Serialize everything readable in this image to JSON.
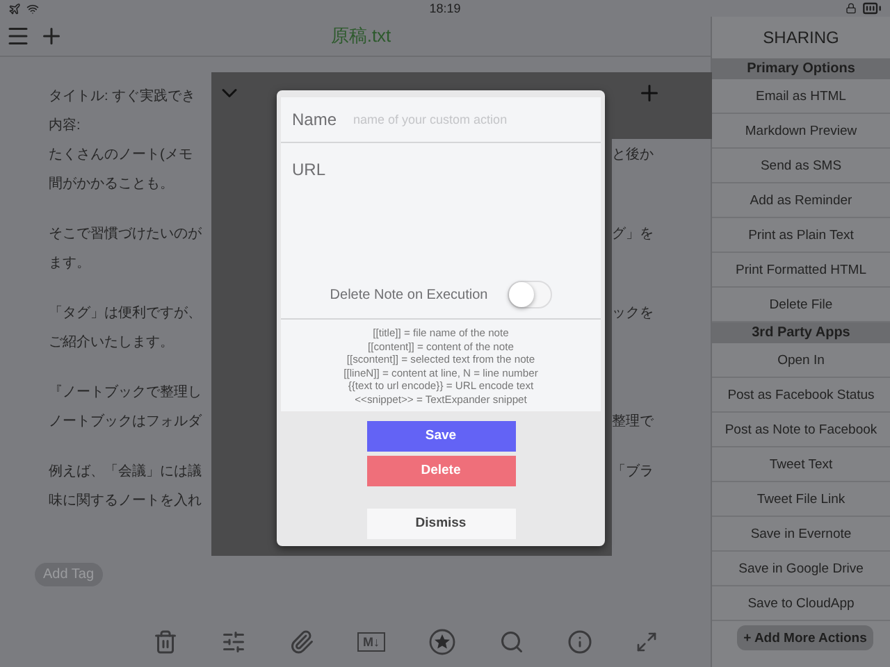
{
  "status_bar": {
    "time": "18:19"
  },
  "nav": {
    "title": "原稿.txt"
  },
  "note": {
    "paragraphs": [
      {
        "lines": [
          {
            "left": "タイトル: すぐ実践でき"
          },
          {
            "left": "内容:"
          },
          {
            "left": "たくさんのノート(メモ",
            "right": "と後か"
          },
          {
            "left": "間がかかることも。"
          }
        ]
      },
      {
        "lines": [
          {
            "left": "そこで習慣づけたいのが",
            "right": "グ」を"
          },
          {
            "left": "ます。"
          }
        ]
      },
      {
        "lines": [
          {
            "left": "「タグ」は便利ですが、",
            "right": "ックを"
          },
          {
            "left": "ご紹介いたします。"
          }
        ]
      },
      {
        "lines": [
          {
            "left": "『ノートブックで整理し"
          },
          {
            "left": "ノートブックはフォルダ",
            "right": "整理で"
          }
        ]
      },
      {
        "lines": [
          {
            "left": "例えば、「会議」には議",
            "right": "「ブラ"
          },
          {
            "left": "味に関するノートを入れ"
          }
        ]
      }
    ],
    "tag_button": "Add Tag"
  },
  "toolbar": {
    "markdown_badge": "M↓"
  },
  "dialog": {
    "name_field": {
      "label": "Name",
      "placeholder": "name of your custom action"
    },
    "url_field": {
      "label": "URL"
    },
    "delete_on_execution": {
      "label": "Delete Note on Execution",
      "on": false
    },
    "help_lines": [
      "[[title]] = file name of the note",
      "[[content]] = content of the note",
      "[[scontent]] = selected text from the note",
      "[[lineN]] = content at line, N = line number",
      "{{text to url encode}} = URL encode text",
      "<<snippet>> = TextExpander snippet"
    ],
    "buttons": [
      {
        "label": "Save",
        "kind": "primary"
      },
      {
        "label": "Delete",
        "kind": "danger"
      },
      {
        "label": "Dismiss",
        "kind": "plain"
      }
    ]
  },
  "sharing": {
    "title": "SHARING",
    "sections": [
      {
        "title": "Primary Options",
        "items": [
          "Email as HTML",
          "Markdown Preview",
          "Send as SMS",
          "Add as Reminder",
          "Print as Plain Text",
          "Print Formatted HTML",
          "Delete File"
        ]
      },
      {
        "title": "3rd Party Apps",
        "items": [
          "Open In",
          "Post as Facebook Status",
          "Post as Note to Facebook",
          "Tweet Text",
          "Tweet File Link",
          "Save in Evernote",
          "Save in Google Drive",
          "Save to CloudApp"
        ]
      }
    ],
    "add_button": "+ Add More Actions"
  }
}
